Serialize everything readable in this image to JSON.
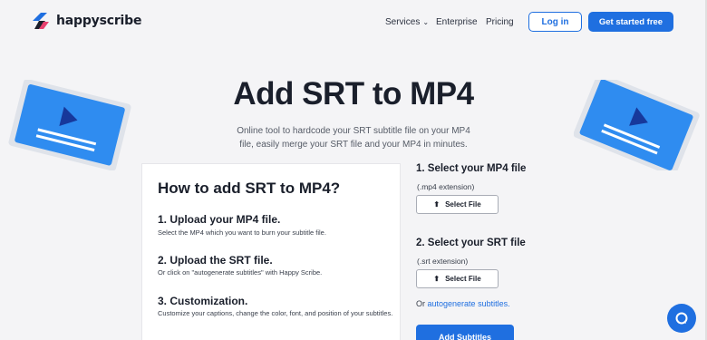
{
  "brand": {
    "name": "happyscribe",
    "accent": "#1f6fe0"
  },
  "nav": {
    "services": "Services",
    "enterprise": "Enterprise",
    "pricing": "Pricing",
    "login": "Log in",
    "get_started": "Get started free"
  },
  "hero": {
    "title": "Add SRT to MP4",
    "subtitle": "Online tool to hardcode your SRT subtitle file on your MP4 file, easily merge your SRT file and your MP4 in minutes."
  },
  "howto": {
    "title": "How to add SRT to MP4?",
    "steps": [
      {
        "title": "1. Upload your MP4 file.",
        "desc": "Select the MP4 which you want to burn your subtitle file."
      },
      {
        "title": "2. Upload the SRT file.",
        "desc": "Or click on \"autogenerate subtitles\" with Happy Scribe."
      },
      {
        "title": "3. Customization.",
        "desc": "Customize your captions, change the color, font, and position of your subtitles."
      }
    ]
  },
  "upload": {
    "mp4": {
      "title": "1.  Select your MP4 file",
      "ext": "(.mp4 extension)",
      "button": "Select File"
    },
    "srt": {
      "title": "2.  Select your SRT file",
      "ext": "(.srt extension)",
      "button": "Select File"
    },
    "or_text": "Or",
    "autogen_link": "autogenerate subtitles.",
    "add_button": "Add Subtitles"
  },
  "icons": [
    "logo-icon",
    "chevron-down-icon",
    "upload-icon",
    "chat-icon",
    "video-illustration-icon"
  ]
}
